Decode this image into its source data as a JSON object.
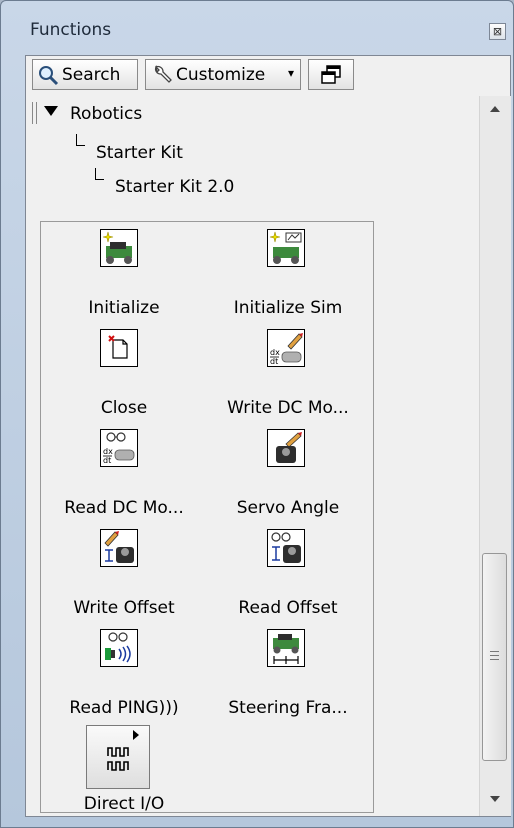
{
  "window": {
    "title": "Functions",
    "close_glyph": "⊠"
  },
  "toolbar": {
    "search_label": "Search",
    "customize_label": "Customize",
    "customize_caret": "▾"
  },
  "tree": [
    {
      "label": "Robotics"
    },
    {
      "label": "Starter Kit"
    },
    {
      "label": "Starter Kit 2.0"
    }
  ],
  "palette": {
    "items": [
      {
        "label": "Initialize",
        "icon": "robot-initialize-icon"
      },
      {
        "label": "Initialize Sim",
        "icon": "robot-initialize-sim-icon"
      },
      {
        "label": "Close",
        "icon": "close-reference-icon"
      },
      {
        "label": "Write DC Mo...",
        "icon": "write-dc-motor-icon"
      },
      {
        "label": "Read DC Mo...",
        "icon": "read-dc-motor-icon"
      },
      {
        "label": "Servo Angle",
        "icon": "servo-angle-icon"
      },
      {
        "label": "Write Offset",
        "icon": "write-offset-icon"
      },
      {
        "label": "Read Offset",
        "icon": "read-offset-icon"
      },
      {
        "label": "Read PING)))",
        "icon": "read-ping-icon"
      },
      {
        "label": "Steering Fra...",
        "icon": "steering-frame-icon"
      },
      {
        "label": "Direct I/O",
        "icon": "direct-io-icon"
      }
    ]
  },
  "colors": {
    "window_frame": "#b5c7dc",
    "panel_bg": "#f0f0f0",
    "icon_border": "#000000"
  }
}
